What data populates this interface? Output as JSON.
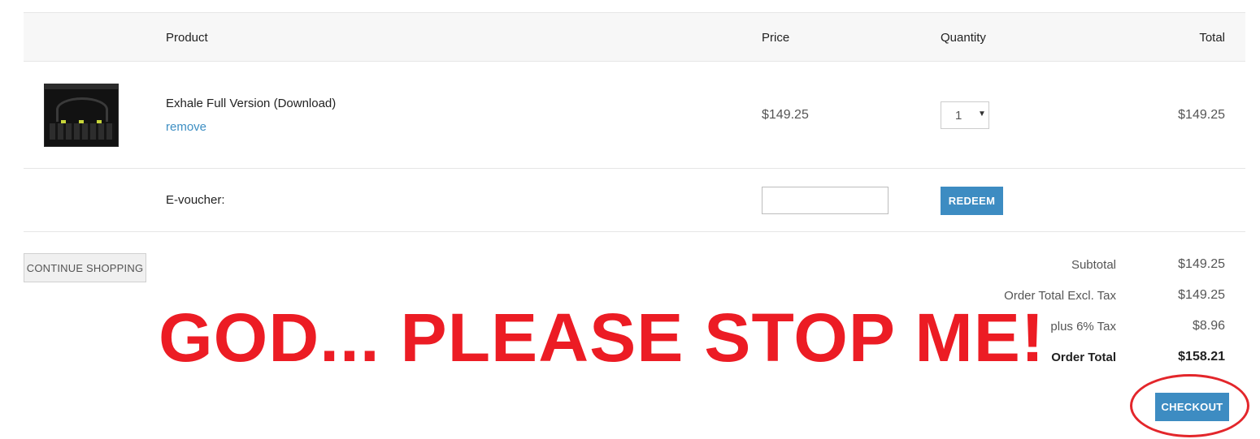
{
  "table_header": {
    "product": "Product",
    "price": "Price",
    "quantity": "Quantity",
    "total": "Total"
  },
  "cart_item": {
    "name": "Exhale Full Version (Download)",
    "remove_label": "remove",
    "price": "$149.25",
    "quantity": "1",
    "total": "$149.25",
    "thumbnail_icon": "product-thumbnail"
  },
  "voucher": {
    "label": "E-voucher:",
    "input_value": "",
    "redeem_label": "REDEEM"
  },
  "continue_label": "CONTINUE SHOPPING",
  "totals": {
    "subtotal_label": "Subtotal",
    "subtotal_value": "$149.25",
    "excl_tax_label": "Order Total Excl. Tax",
    "excl_tax_value": "$149.25",
    "tax_label": "plus 6% Tax",
    "tax_value": "$8.96",
    "order_total_label": "Order Total",
    "order_total_value": "$158.21"
  },
  "checkout_label": "CHECKOUT",
  "overlay_text": "GOD... PLEASE STOP ME!",
  "colors": {
    "accent": "#3d8cc2",
    "overlay_red": "#ec1c24",
    "link": "#3e8fc3"
  }
}
